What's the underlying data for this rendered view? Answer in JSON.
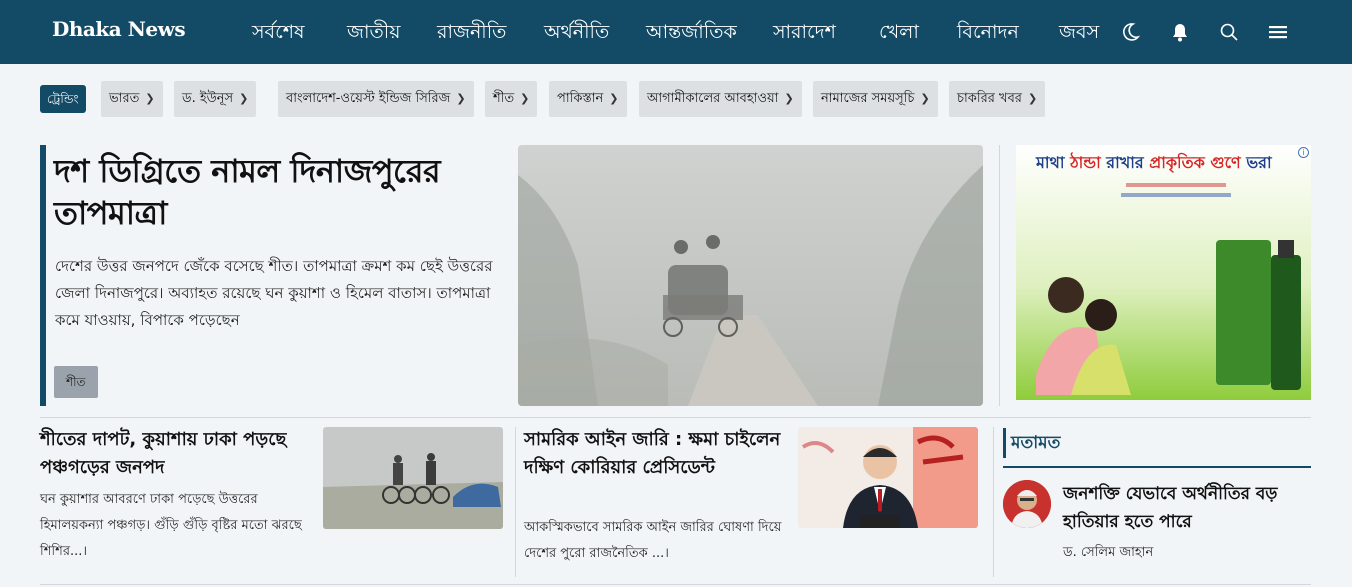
{
  "header": {
    "logo": "Dhaka News",
    "nav": [
      "সর্বশেষ",
      "জাতীয়",
      "রাজনীতি",
      "অর্থনীতি",
      "আন্তর্জাতিক",
      "সারাদেশ",
      "খেলা",
      "বিনোদন",
      "জবস"
    ],
    "icons": [
      "moon-icon",
      "bell-icon",
      "search-icon",
      "menu-icon"
    ],
    "bg_color": "#134a66"
  },
  "trending": {
    "label": "ট্রেন্ডিং",
    "chips": [
      "ভারত",
      "ড. ইউনূস",
      "বাংলাদেশ-ওয়েস্ট ইন্ডিজ সিরিজ",
      "শীত",
      "পাকিস্তান",
      "আগামীকালের আবহাওয়া",
      "নামাজের সময়সূচি",
      "চাকরির খবর"
    ]
  },
  "lead": {
    "title": "দশ ডিগ্রিতে নামল দিনাজপুরের তাপমাত্রা",
    "desc": "দেশের উত্তর জনপদে জেঁকে বসেছে শীত। তাপমাত্রা ক্রমশ কম ছেই উত্তরের জেলা দিনাজপুরে। অব্যাহত রয়েছে ঘন কুয়াশা ও হিমেল বাতাস। তাপমাত্রা কমে যাওয়ায়, বিপাকে পড়েছেন",
    "tag": "শীত"
  },
  "ad": {
    "headline_pre": "মাথা ",
    "headline_hot": "ঠান্ডা",
    "headline_mid": " রাখার ",
    "headline_hot2": "প্রাকৃতিক গুণে",
    "headline_post": " ভরা"
  },
  "stories": [
    {
      "title": "শীতের দাপট, কুয়াশায় ঢাকা পড়ছে পঞ্চগড়ের জনপদ",
      "desc": "ঘন কুয়াশার আবরণে ঢাকা পড়েছে উত্তরের হিমালয়কন্যা পঞ্চগড়। গুঁড়ি গুঁড়ি বৃষ্টির মতো ঝরছে শিশির...।"
    },
    {
      "title": "সামরিক আইন জারি : ক্ষমা চাইলেন দক্ষিণ কোরিয়ার প্রেসিডেন্ট",
      "desc": "আকস্মিকভাবে সামরিক আইন জারির ঘোষণা দিয়ে দেশের পুরো রাজনৈতিক ...।"
    }
  ],
  "opinion": {
    "label": "মতামত",
    "title": "জনশক্তি যেভাবে অর্থনীতির বড় হাতিয়ার হতে পারে",
    "author": "ড. সেলিম জাহান"
  }
}
